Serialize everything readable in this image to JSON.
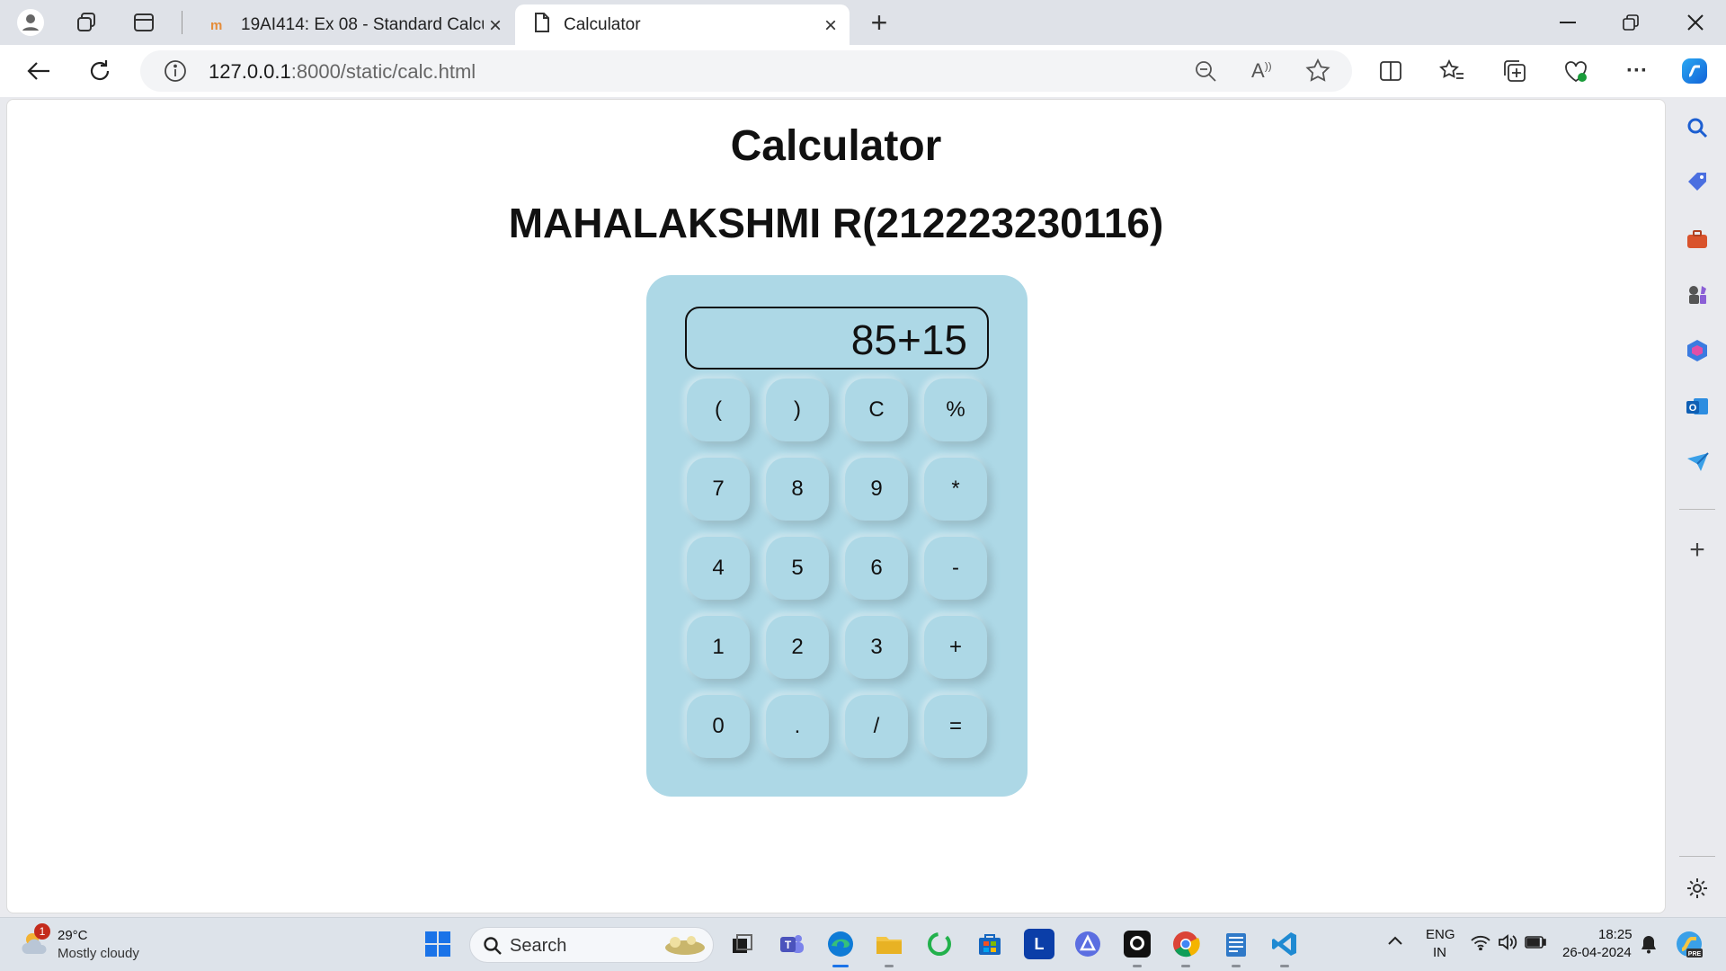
{
  "browser": {
    "tabs": [
      {
        "title": "19AI414: Ex 08 - Standard Calcul"
      },
      {
        "title": "Calculator"
      }
    ],
    "url_host": "127.0.0.1",
    "url_path": ":8000/static/calc.html"
  },
  "page": {
    "title": "Calculator",
    "subtitle": "MAHALAKSHMI R(212223230116)"
  },
  "calculator": {
    "display": "85+15",
    "keys": [
      "(",
      ")",
      "C",
      "%",
      "7",
      "8",
      "9",
      "*",
      "4",
      "5",
      "6",
      "-",
      "1",
      "2",
      "3",
      "+",
      "0",
      ".",
      "/",
      "="
    ],
    "bg_color": "#add8e6"
  },
  "taskbar": {
    "weather_temp": "29°C",
    "weather_desc": "Mostly cloudy",
    "weather_badge": "1",
    "search_label": "Search",
    "lang_line1": "ENG",
    "lang_line2": "IN",
    "time": "18:25",
    "date": "26-04-2024",
    "pinned_letter": "L"
  }
}
